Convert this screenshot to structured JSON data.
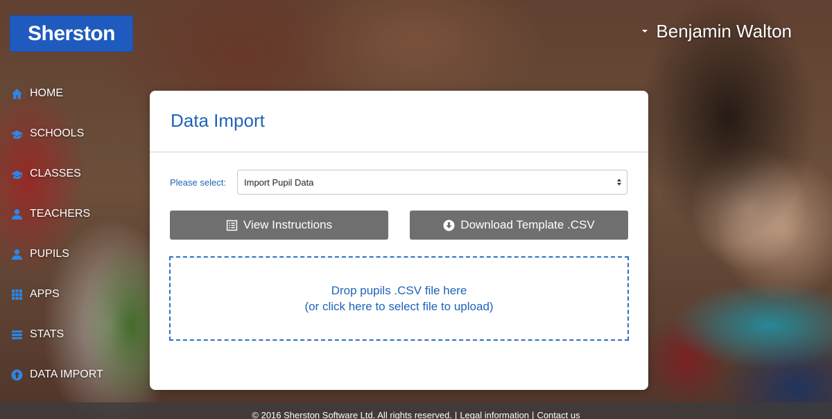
{
  "brand": {
    "logo_text": "Sherston"
  },
  "user": {
    "name": "Benjamin Walton"
  },
  "nav": {
    "items": [
      {
        "label": "HOME",
        "icon": "home-icon"
      },
      {
        "label": "SCHOOLS",
        "icon": "graduation-cap-icon"
      },
      {
        "label": "CLASSES",
        "icon": "graduation-cap-icon"
      },
      {
        "label": "TEACHERS",
        "icon": "user-icon"
      },
      {
        "label": "PUPILS",
        "icon": "user-icon"
      },
      {
        "label": "APPS",
        "icon": "grid-icon"
      },
      {
        "label": "STATS",
        "icon": "server-icon"
      },
      {
        "label": "DATA IMPORT",
        "icon": "upload-circle-icon"
      }
    ]
  },
  "card": {
    "title": "Data Import",
    "select_label": "Please select:",
    "select_value": "Import Pupil Data",
    "view_instructions": "View Instructions",
    "download_template": "Download Template .CSV",
    "dropzone_line1": "Drop pupils .CSV file here",
    "dropzone_line2": "(or click here to select file to upload)"
  },
  "footer": {
    "copyright": "© 2016 Sherston Software Ltd. All rights reserved.",
    "sep1": "|",
    "legal": "Legal information",
    "sep2": "|",
    "contact": "Contact us"
  },
  "colors": {
    "brand_blue": "#1f5bbf",
    "accent_blue": "#1f63b8",
    "button_gray": "#6f6f6f",
    "nav_icon_blue": "#2f86e6"
  }
}
